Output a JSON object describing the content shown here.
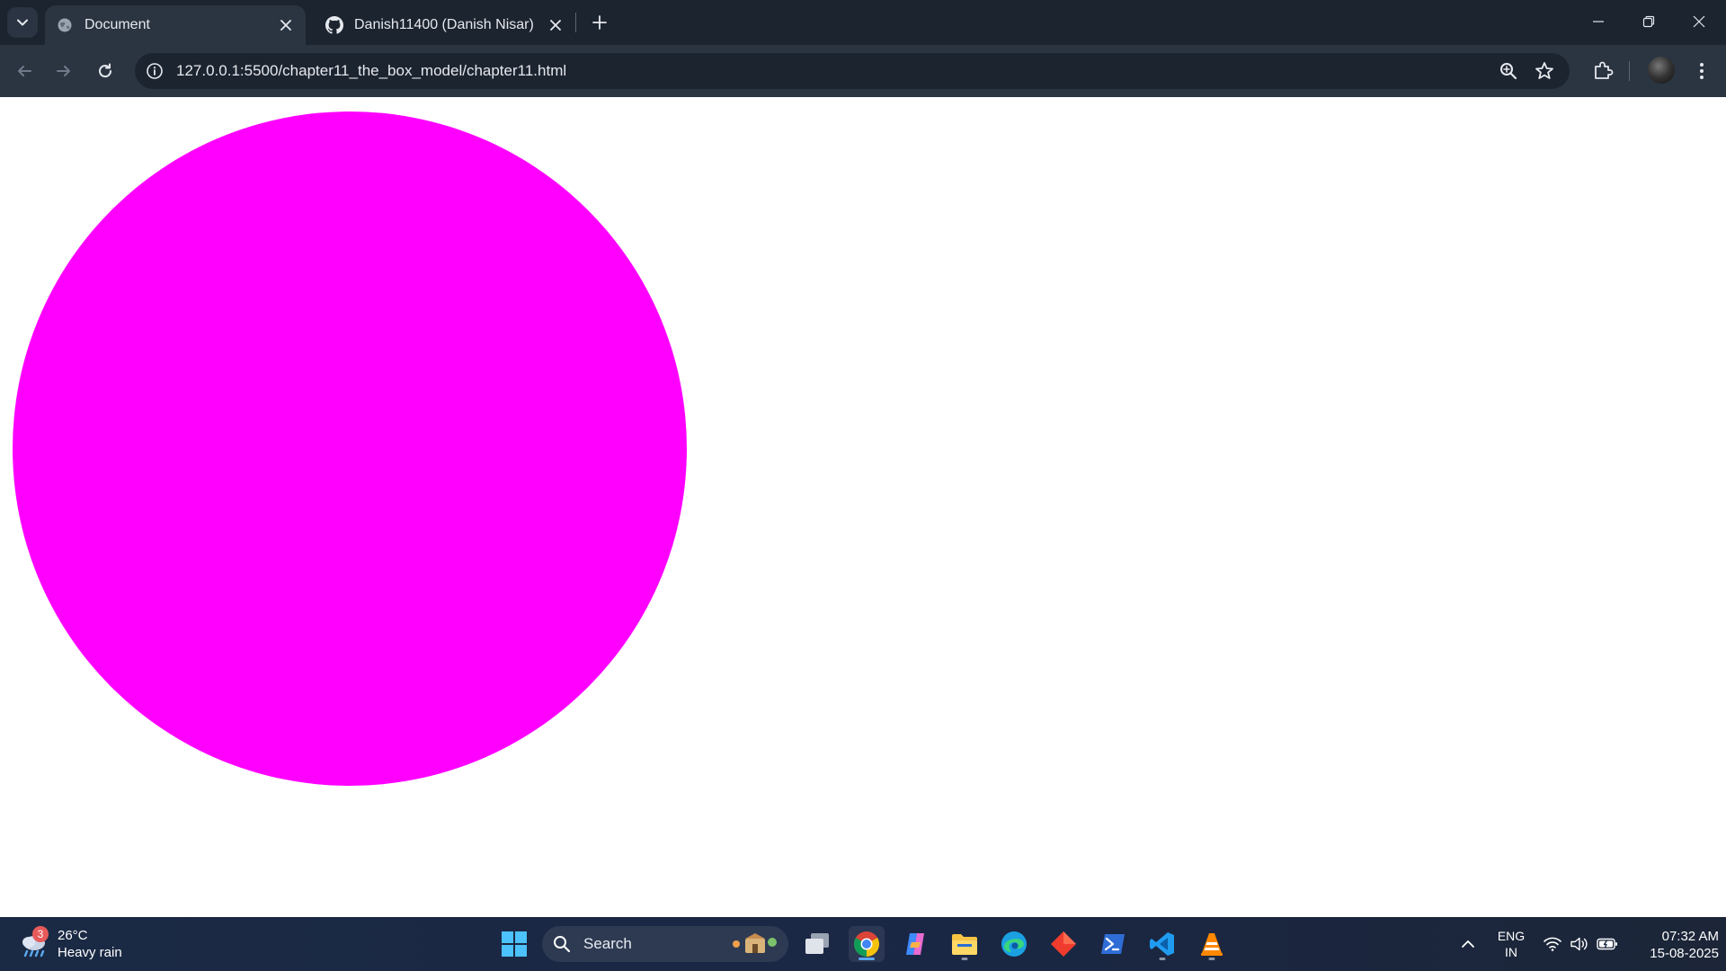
{
  "browser": {
    "tabs": [
      {
        "title": "Document",
        "favicon": "globe-icon",
        "active": true
      },
      {
        "title": "Danish11400 (Danish Nisar)",
        "favicon": "github-icon",
        "active": false
      }
    ],
    "url": "127.0.0.1:5500/chapter11_the_box_model/chapter11.html",
    "colors": {
      "tabstrip": "#1c2430",
      "toolbar": "#2b3542"
    }
  },
  "page": {
    "circle_color": "#ff00ff",
    "background": "#ffffff"
  },
  "taskbar": {
    "weather": {
      "badge": "3",
      "temperature": "26°C",
      "condition": "Heavy rain"
    },
    "search_placeholder": "Search",
    "apps": [
      "windows-start",
      "task-view",
      "chrome",
      "copilot",
      "file-explorer",
      "edge",
      "git-app",
      "powershell",
      "vscode",
      "vlc"
    ],
    "language": {
      "line1": "ENG",
      "line2": "IN"
    },
    "clock": {
      "time": "07:32 AM",
      "date": "15-08-2025"
    }
  }
}
